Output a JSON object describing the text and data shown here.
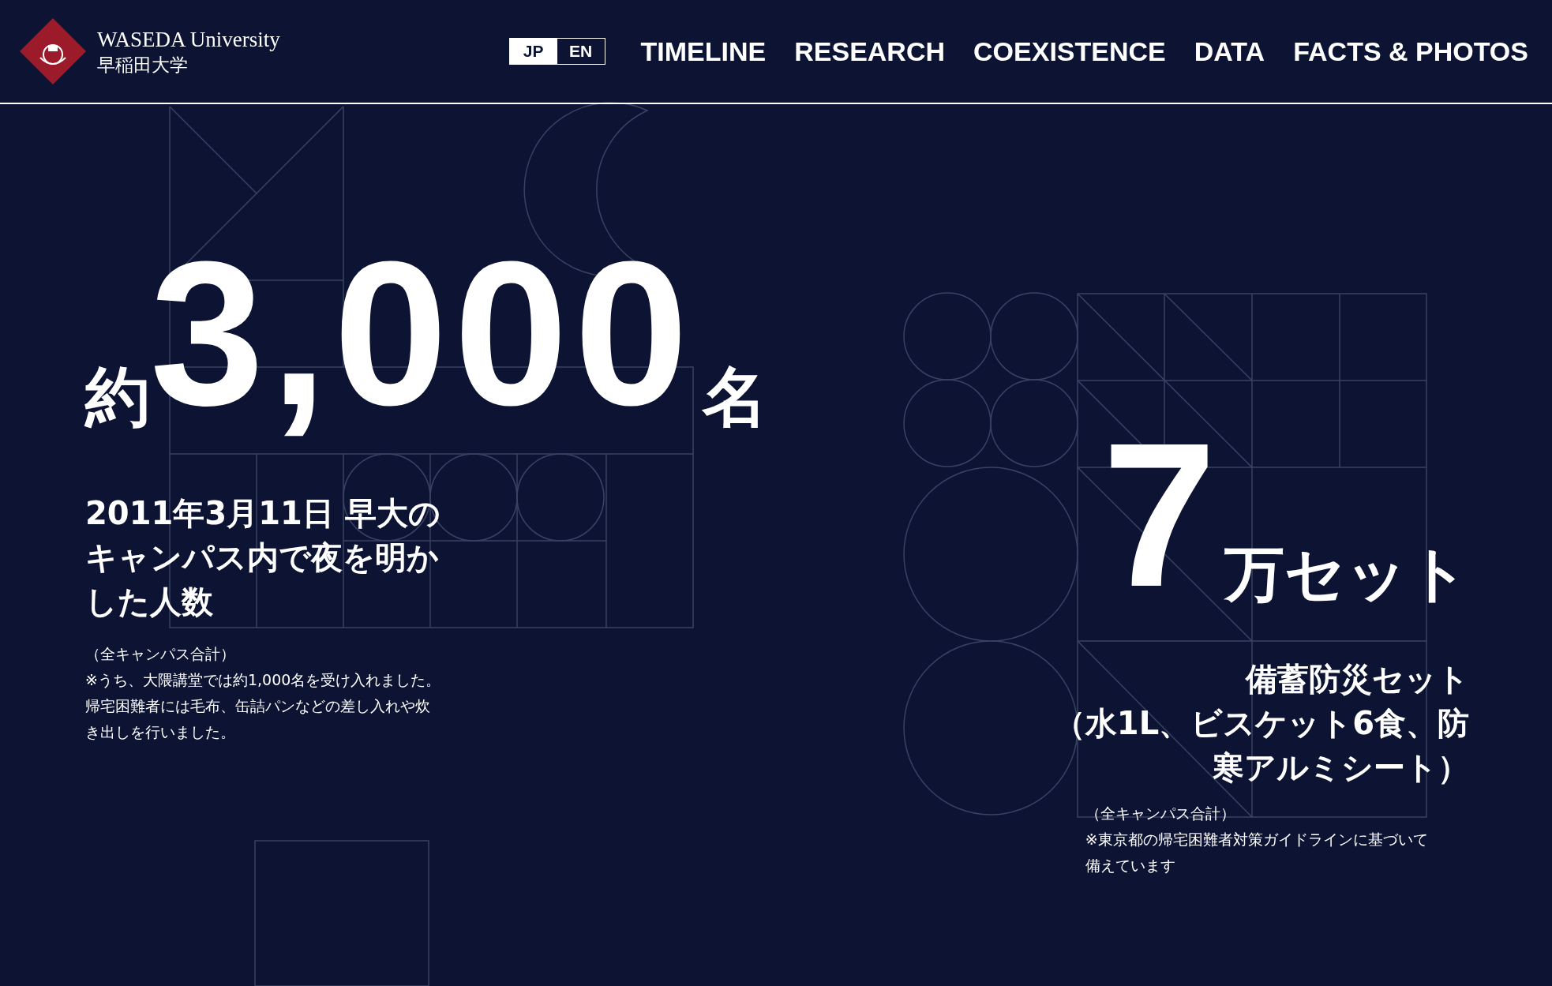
{
  "header": {
    "logo_en": "WASEDA University",
    "logo_ja": "早稲田大学",
    "languages": [
      {
        "label": "JP",
        "selected": true
      },
      {
        "label": "EN",
        "selected": false
      }
    ],
    "nav": [
      "TIMELINE",
      "RESEARCH",
      "COEXISTENCE",
      "DATA",
      "FACTS & PHOTOS"
    ]
  },
  "stats": [
    {
      "prefix": "約",
      "number": "3,000",
      "unit": "名",
      "heading": [
        "2011年3月11日 早大の",
        "キャンパス内で夜を明か",
        "した人数"
      ],
      "notes": [
        "（全キャンパス合計）",
        "※うち、大隈講堂では約1,000名を受け入れました。",
        "帰宅困難者には毛布、缶詰パンなどの差し入れや炊",
        "き出しを行いました。"
      ]
    },
    {
      "number": "7",
      "unit": "万セット",
      "heading": [
        "備蓄防災セット",
        "（水1L、ビスケット6食、防",
        "寒アルミシート）"
      ],
      "notes": [
        "（全キャンパス合計）",
        "※東京都の帰宅困難者対策ガイドラインに基づいて",
        "備えています"
      ]
    }
  ]
}
